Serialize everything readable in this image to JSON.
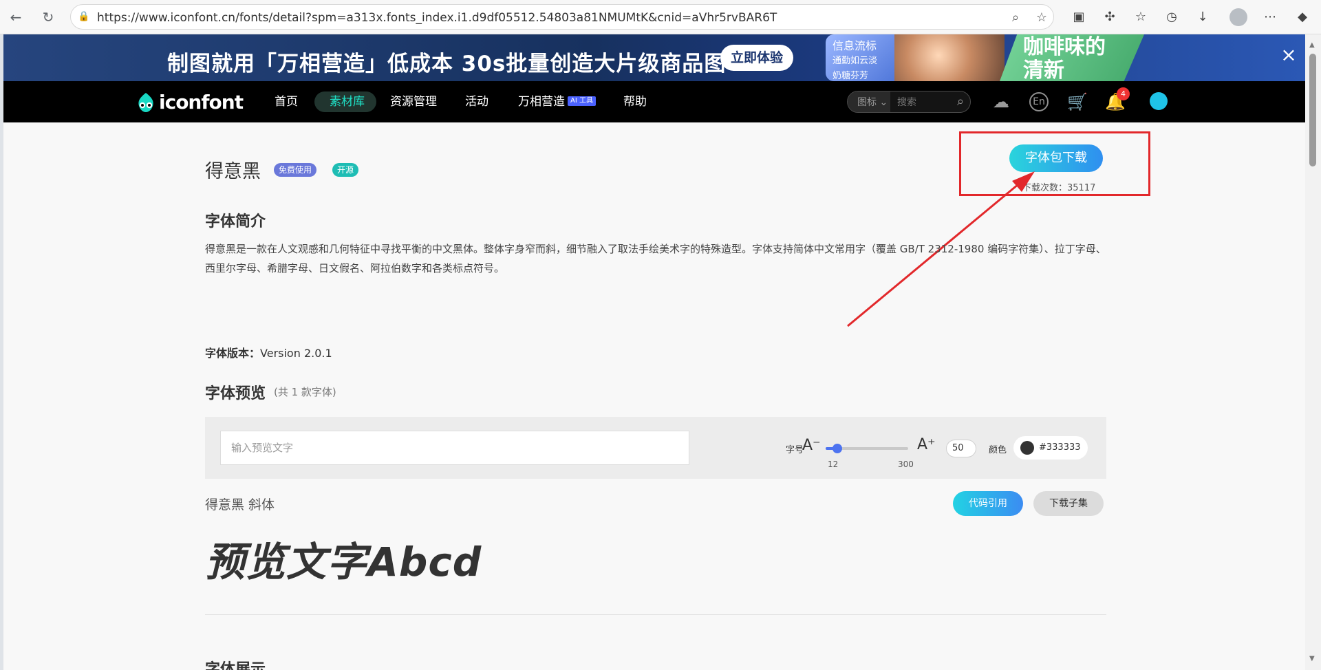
{
  "browser": {
    "url": "https://www.iconfont.cn/fonts/detail?spm=a313x.fonts_index.i1.d9df05512.54803a81NMUMtK&cnid=aVhr5rvBAR6T"
  },
  "banner": {
    "headline": "制图就用「万相营造」低成本 30s批量创造大片级商品图",
    "cta": "立即体验",
    "art_text_1": "信息流标",
    "art_text_2": "通勤如云淡",
    "art_text_3": "奶糖芬芳",
    "art_text_4": "咖啡味的",
    "art_text_5": "清新"
  },
  "nav": {
    "logo_text": "iconfont",
    "items": [
      "首页",
      "素材库",
      "资源管理",
      "活动",
      "万相营造",
      "帮助"
    ],
    "ai_tag": "AI 工具",
    "search_type": "图标",
    "search_placeholder": "搜索",
    "en_label": "En",
    "notification_count": "4"
  },
  "font": {
    "name": "得意黑",
    "tags": [
      "免费使用",
      "开源"
    ],
    "download_button": "字体包下载",
    "download_count": "下载次数：35117",
    "intro_title": "字体简介",
    "intro_text": "得意黑是一款在人文观感和几何特征中寻找平衡的中文黑体。整体字身窄而斜，细节融入了取法手绘美术字的特殊造型。字体支持简体中文常用字（覆盖 GB/T 2312-1980 编码字符集）、拉丁字母、西里尔字母、希腊字母、日文假名、阿拉伯数字和各类标点符号。",
    "version_label": "字体版本：",
    "version": "Version 2.0.1",
    "preview_title": "字体预览",
    "preview_subtitle": "(共 1 款字体)",
    "preview_placeholder": "输入预览文字",
    "size_label": "字号",
    "a_minus": "A⁻",
    "a_plus": "A⁺",
    "size_min": "12",
    "size_max": "300",
    "size_value": "50",
    "color_label": "颜色",
    "color_value": "#333333",
    "sample_name": "得意黑 斜体",
    "code_button": "代码引用",
    "subset_button": "下载子集",
    "sample_text": "预览文字Abcd",
    "showcase_title": "字体展示"
  },
  "colors": {
    "accent": "#1fe0c6",
    "annotation": "#e2282b",
    "text_color": "#333333"
  }
}
